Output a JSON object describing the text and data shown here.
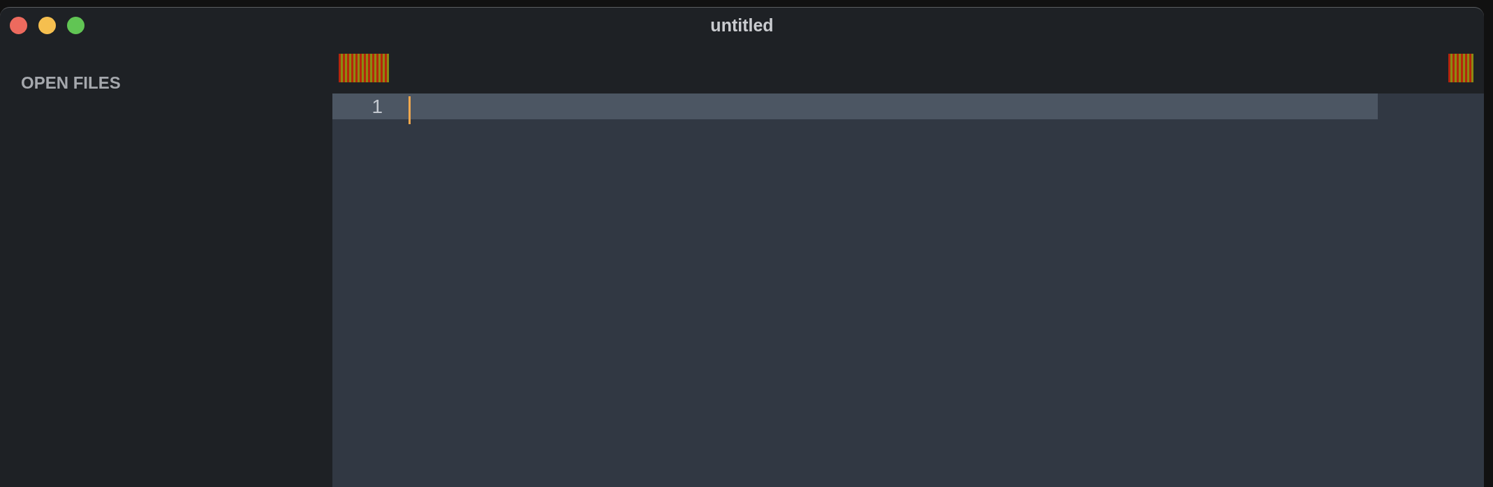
{
  "window": {
    "title": "untitled"
  },
  "sidebar": {
    "heading": "OPEN FILES"
  },
  "editor": {
    "lines": [
      {
        "number": "1",
        "current": true
      }
    ]
  }
}
